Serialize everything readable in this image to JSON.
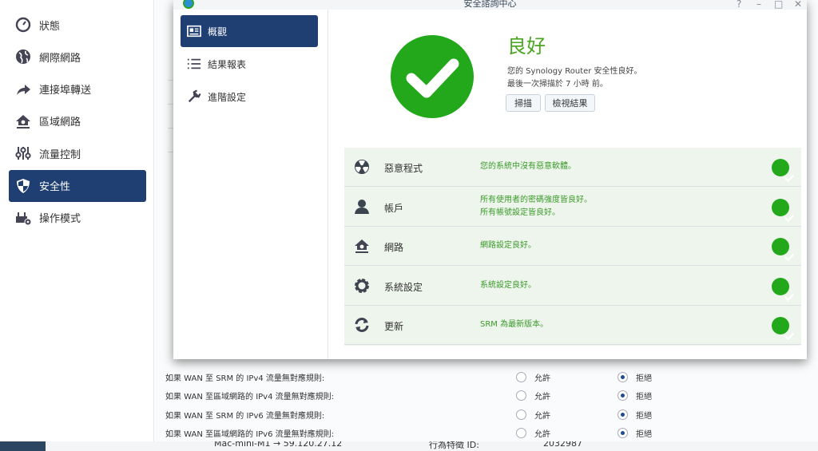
{
  "sidebar": {
    "items": [
      {
        "label": "狀態",
        "icon": "gauge-icon"
      },
      {
        "label": "網際網路",
        "icon": "globe-icon"
      },
      {
        "label": "連接埠轉送",
        "icon": "forward-arrow-icon"
      },
      {
        "label": "區域網路",
        "icon": "home-network-icon"
      },
      {
        "label": "流量控制",
        "icon": "sliders-icon"
      },
      {
        "label": "安全性",
        "icon": "shield-icon",
        "active": true
      },
      {
        "label": "操作模式",
        "icon": "router-gear-icon"
      }
    ]
  },
  "modal": {
    "title": "安全諮詢中心",
    "nav": [
      {
        "label": "概觀",
        "icon": "overview-card-icon",
        "active": true
      },
      {
        "label": "結果報表",
        "icon": "list-icon"
      },
      {
        "label": "進階設定",
        "icon": "wrench-icon"
      }
    ],
    "status": "良好",
    "summary": "您的 Synology Router 安全性良好。",
    "last_scan": "最後一次掃描於 7 小時 前。",
    "scan_button": "掃描",
    "view_results_button": "檢視結果",
    "checks": [
      {
        "name": "惡意程式",
        "icon": "radiation-icon",
        "desc": [
          "您的系統中沒有惡意軟體。"
        ]
      },
      {
        "name": "帳戶",
        "icon": "user-icon",
        "desc": [
          "所有使用者的密碼強度皆良好。",
          "所有帳號設定皆良好。"
        ]
      },
      {
        "name": "網路",
        "icon": "home-network-icon",
        "desc": [
          "網路設定良好。"
        ]
      },
      {
        "name": "系統設定",
        "icon": "gear-icon",
        "desc": [
          "系統設定良好。"
        ]
      },
      {
        "name": "更新",
        "icon": "refresh-icon",
        "desc": [
          "SRM 為最新版本。"
        ]
      }
    ]
  },
  "firewall": {
    "allow": "允許",
    "deny": "拒絕",
    "rules": [
      {
        "label": "如果 WAN 至 SRM 的 IPv4 流量無對應規則:",
        "selected": "deny"
      },
      {
        "label": "如果 WAN 至區域網路的 IPv4 流量無對應規則:",
        "selected": "deny"
      },
      {
        "label": "如果 WAN 至 SRM 的 IPv6 流量無對應規則:",
        "selected": "deny"
      },
      {
        "label": "如果 WAN 至區域網路的 IPv6 流量無對應規則:",
        "selected": "deny"
      }
    ]
  },
  "bottom": {
    "device": "Mac-mini-M1 → 59.120.27.12",
    "sig_label": "行為特徵 ID:",
    "sig_value": "2032987"
  },
  "colors": {
    "accent": "#1f3f73",
    "good": "#22a81a"
  }
}
